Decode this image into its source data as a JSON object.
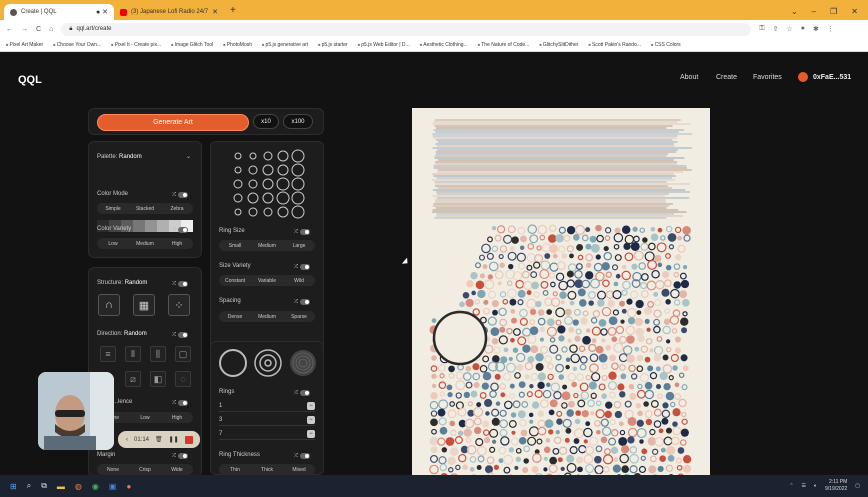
{
  "browser": {
    "tabs": [
      {
        "title": "Create | QQL",
        "active": true
      },
      {
        "title": "(3) Japanese Lofi Radio 24/7",
        "active": false
      }
    ],
    "url": "qql.art/create",
    "bookmarks": [
      "Pixel Art Maker",
      "Choose Your Own...",
      "Pixel It - Create pix...",
      "Image Glitch Tool",
      "PhotoMosh",
      "p5.js generative art",
      "p5.js starter",
      "p5.js Web Editor | D...",
      "Aesthetic Clothing...",
      "The Nature of Code...",
      "GlitchySlitDither",
      "Scott Pakin's Rando...",
      "CSS Colors"
    ]
  },
  "header": {
    "logo": "QQL",
    "nav": [
      "About",
      "Create",
      "Favorites"
    ],
    "wallet": "0xFaE...531"
  },
  "generate": {
    "label": "Generate Art",
    "x10": "x10",
    "x100": "x100"
  },
  "palette": {
    "label": "Palette:",
    "value": "Random",
    "swatches": [
      "#2b2b2b",
      "#444444",
      "#5c5c5c",
      "#777777",
      "#939393",
      "#b0b0b0",
      "#cdcdcd",
      "#ececec"
    ]
  },
  "color_mode": {
    "label": "Color Mode",
    "options": [
      "Simple",
      "Stacked",
      "Zebra"
    ]
  },
  "color_variety": {
    "label": "Color Variety",
    "options": [
      "Low",
      "Medium",
      "High"
    ]
  },
  "structure": {
    "label": "Structure:",
    "value": "Random"
  },
  "direction": {
    "label": "Direction:",
    "value": "Random"
  },
  "turbulence": {
    "label": "...lence",
    "options": [
      "None",
      "Low",
      "High"
    ]
  },
  "margin": {
    "label": "Margin",
    "options": [
      "None",
      "Crisp",
      "Wide"
    ]
  },
  "ring_size": {
    "label": "Ring Size",
    "options": [
      "Small",
      "Medium",
      "Large"
    ]
  },
  "size_variety": {
    "label": "Size Variety",
    "options": [
      "Constant",
      "Variable",
      "Wild"
    ]
  },
  "spacing": {
    "label": "Spacing",
    "options": [
      "Dense",
      "Medium",
      "Sparse"
    ]
  },
  "rings": {
    "label": "Rings",
    "values": [
      "1",
      "3",
      "7"
    ]
  },
  "ring_thickness": {
    "label": "Ring Thickness",
    "options": [
      "Thin",
      "Thick",
      "Mixed"
    ]
  },
  "recorder": {
    "time": "01:14"
  },
  "taskbar": {
    "time": "2:11 PM",
    "date": "9/19/2022"
  },
  "colors": {
    "accent": "#e45d2c",
    "canvas_bg": "#f2ede3"
  }
}
